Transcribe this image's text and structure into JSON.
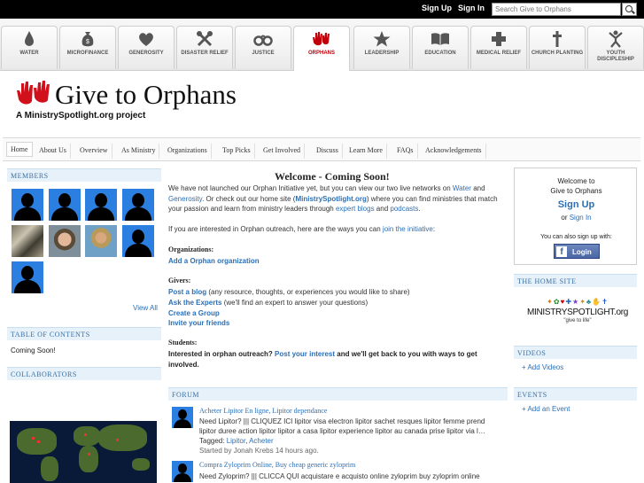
{
  "topbar": {
    "sign_up": "Sign Up",
    "sign_in": "Sign In",
    "search_placeholder": "Search Give to Orphans"
  },
  "causes": [
    {
      "label": "WATER",
      "icon": "water-drop-icon"
    },
    {
      "label": "MICROFINANCE",
      "icon": "money-bag-icon"
    },
    {
      "label": "GENEROSITY",
      "icon": "heart-icon"
    },
    {
      "label": "DISASTER RELIEF",
      "icon": "crossed-tools-icon"
    },
    {
      "label": "JUSTICE",
      "icon": "handcuffs-icon"
    },
    {
      "label": "ORPHANS",
      "icon": "red-hands-icon"
    },
    {
      "label": "LEADERSHIP",
      "icon": "star-icon"
    },
    {
      "label": "EDUCATION",
      "icon": "open-book-icon"
    },
    {
      "label": "MEDICAL RELIEF",
      "icon": "medical-cross-icon"
    },
    {
      "label": "CHURCH PLANTING",
      "icon": "church-cross-icon"
    },
    {
      "label": "YOUTH DISCIPLESHIP",
      "icon": "youth-figure-icon"
    }
  ],
  "active_cause_color": "#c0000a",
  "site": {
    "title": "Give to Orphans",
    "subtitle": "A MinistrySpotlight.org project"
  },
  "nav": [
    "Home",
    "About Us",
    "Overview",
    "As Ministry",
    "Organizations",
    "Top Picks",
    "Get Involved",
    "Discuss",
    "Learn More",
    "FAQs",
    "Acknowledgements"
  ],
  "left": {
    "members_header": "MEMBERS",
    "view_all": "View All",
    "toc_header": "TABLE OF CONTENTS",
    "toc_text": "Coming Soon!",
    "collaborators_header": "COLLABORATORS"
  },
  "main": {
    "welcome": "Welcome - Coming Soon!",
    "p1_a": "We have not launched our Orphan Initiative yet, but you can view our two live networks on ",
    "p1_water": "Water",
    "p1_and": " and ",
    "p1_generosity": "Generosity",
    "p1_b": ". Or check out our home site (",
    "p1_ms": "MinistrySpotlight.org",
    "p1_c": ") where you can find ministries that match your passion and learn from ministry leaders through ",
    "p1_blogs": "expert blogs",
    "p1_and2": " and ",
    "p1_podcasts": "podcasts",
    "p1_end": ".",
    "p2_a": "If you are interested in Orphan outreach, here are the ways you can ",
    "p2_link": "join the initiative",
    "p2_end": ":",
    "orgs_label": "Organizations:",
    "orgs_link": "Add a Orphan organization",
    "givers_label": "Givers:",
    "g1_link": "Post a blog",
    "g1_text": " (any resource, thoughts, or experiences you would like to share)",
    "g2_link": "Ask the Experts",
    "g2_text": " (we'll find an expert to answer your questions)",
    "g3_link": "Create a Group",
    "g4_link": "Invite your friends",
    "students_label": "Students:",
    "s_a": "Interested in orphan outreach? ",
    "s_link": "Post your interest",
    "s_b": " and we'll get back to you with ways to get involved.",
    "forum_header": "FORUM",
    "posts": [
      {
        "title": "Acheter Lipitor En ligne, Lipitor dependance",
        "body": "Need Lipitor? ||| CLIQUEZ ICI lipitor visa electron lipitor sachet resques lipitor femme prend lipitor duree action lipitor lipitor a casa lipitor experience lipitor au canada prise lipitor via l…",
        "tagged_label": "Tagged: ",
        "tag1": "Lipitor",
        "tag_sep": ", ",
        "tag2": "Acheter",
        "meta": "Started by Jonah Krebs 14 hours ago."
      },
      {
        "title": "Compra Zyloprim Online, Buy cheap generic zyloprim",
        "body": "Need Zyloprim? ||| CLICCA QUI acquistare e acquisto online zyloprim buy zyloprim online"
      }
    ]
  },
  "right": {
    "welcome1": "Welcome to",
    "welcome2": "Give to Orphans",
    "sign_up": "Sign Up",
    "or": "or ",
    "sign_in": "Sign In",
    "also": "You can also sign up with:",
    "fb_login": "Login",
    "home_header": "THE HOME SITE",
    "ms_name": "MINISTRYSPOTLIGHT.org",
    "ms_tag": "\"give to life\"",
    "videos_header": "VIDEOS",
    "add_videos": "+ Add Videos",
    "events_header": "EVENTS",
    "add_event": "+ Add an Event"
  }
}
